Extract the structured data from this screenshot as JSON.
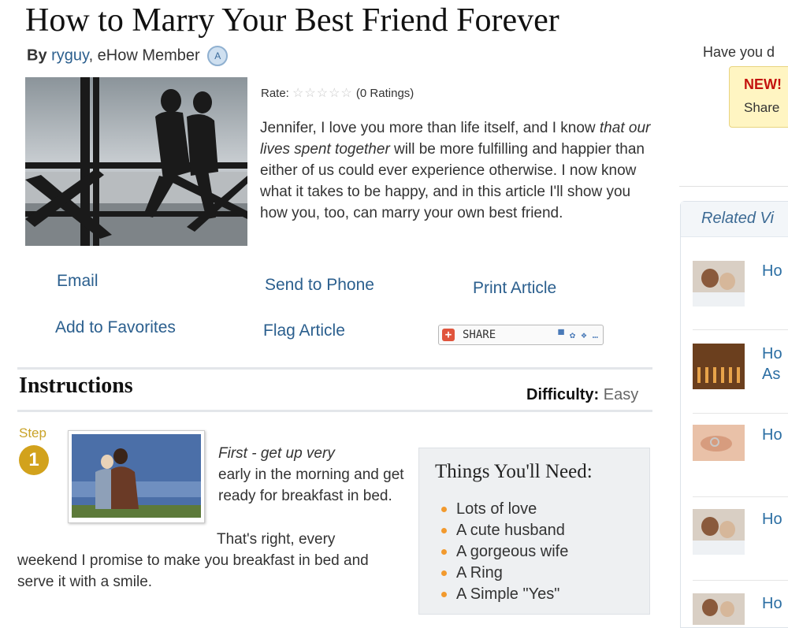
{
  "article": {
    "title": "How to Marry Your Best Friend Forever",
    "by_label": "By",
    "author": "ryguy",
    "author_role": ", eHow Member",
    "rate_label": "Rate:",
    "ratings_count": "(0 Ratings)",
    "intro_html_parts": [
      "Jennifer, I love you more than life itself, and I know ",
      "that our lives spent together",
      " will be more fulfilling and happier than either of us could ever experience otherwise. I now know what it takes to be happy, and in this article I'll show you how you, too, can marry your own best friend."
    ]
  },
  "actions": {
    "email": "Email",
    "send_to_phone": "Send to Phone",
    "print_article": "Print Article",
    "add_to_favorites": "Add to Favorites",
    "flag_article": "Flag Article",
    "share": "SHARE"
  },
  "instructions": {
    "heading": "Instructions",
    "difficulty_label": "Difficulty:",
    "difficulty_value": "Easy",
    "step_label": "Step",
    "step_number": "1",
    "step_text_italic": "First - get up very",
    "step_text_rest_a": "early in the morning and get ready for breakfast in bed.",
    "step_text_rest_b": "That's right, every",
    "step_text_rest_c": "weekend I promise to make you breakfast in bed and serve it with a smile."
  },
  "things_needed": {
    "title": "Things You'll Need:",
    "items": [
      "Lots of love",
      "A cute husband",
      "A gorgeous wife",
      "A Ring",
      "A Simple \"Yes\""
    ]
  },
  "sidebar": {
    "have_you": "Have you d",
    "new_label": "NEW!",
    "new_share": "Share",
    "related_title": "Related Vi",
    "related_items": [
      {
        "label": "Ho"
      },
      {
        "label": "Ho",
        "label2": "As"
      },
      {
        "label": "Ho"
      },
      {
        "label": "Ho"
      },
      {
        "label": "Ho"
      }
    ]
  },
  "icons": {
    "rating_star": "star-outline-icon",
    "badge": "member-badge-icon",
    "share": "share-plus-icon",
    "bullet": "bullet-icon"
  },
  "colors": {
    "link": "#2b5f8e",
    "step_gold": "#d2a21c",
    "bullet_orange": "#f29a2e",
    "new_red": "#c4130e"
  }
}
